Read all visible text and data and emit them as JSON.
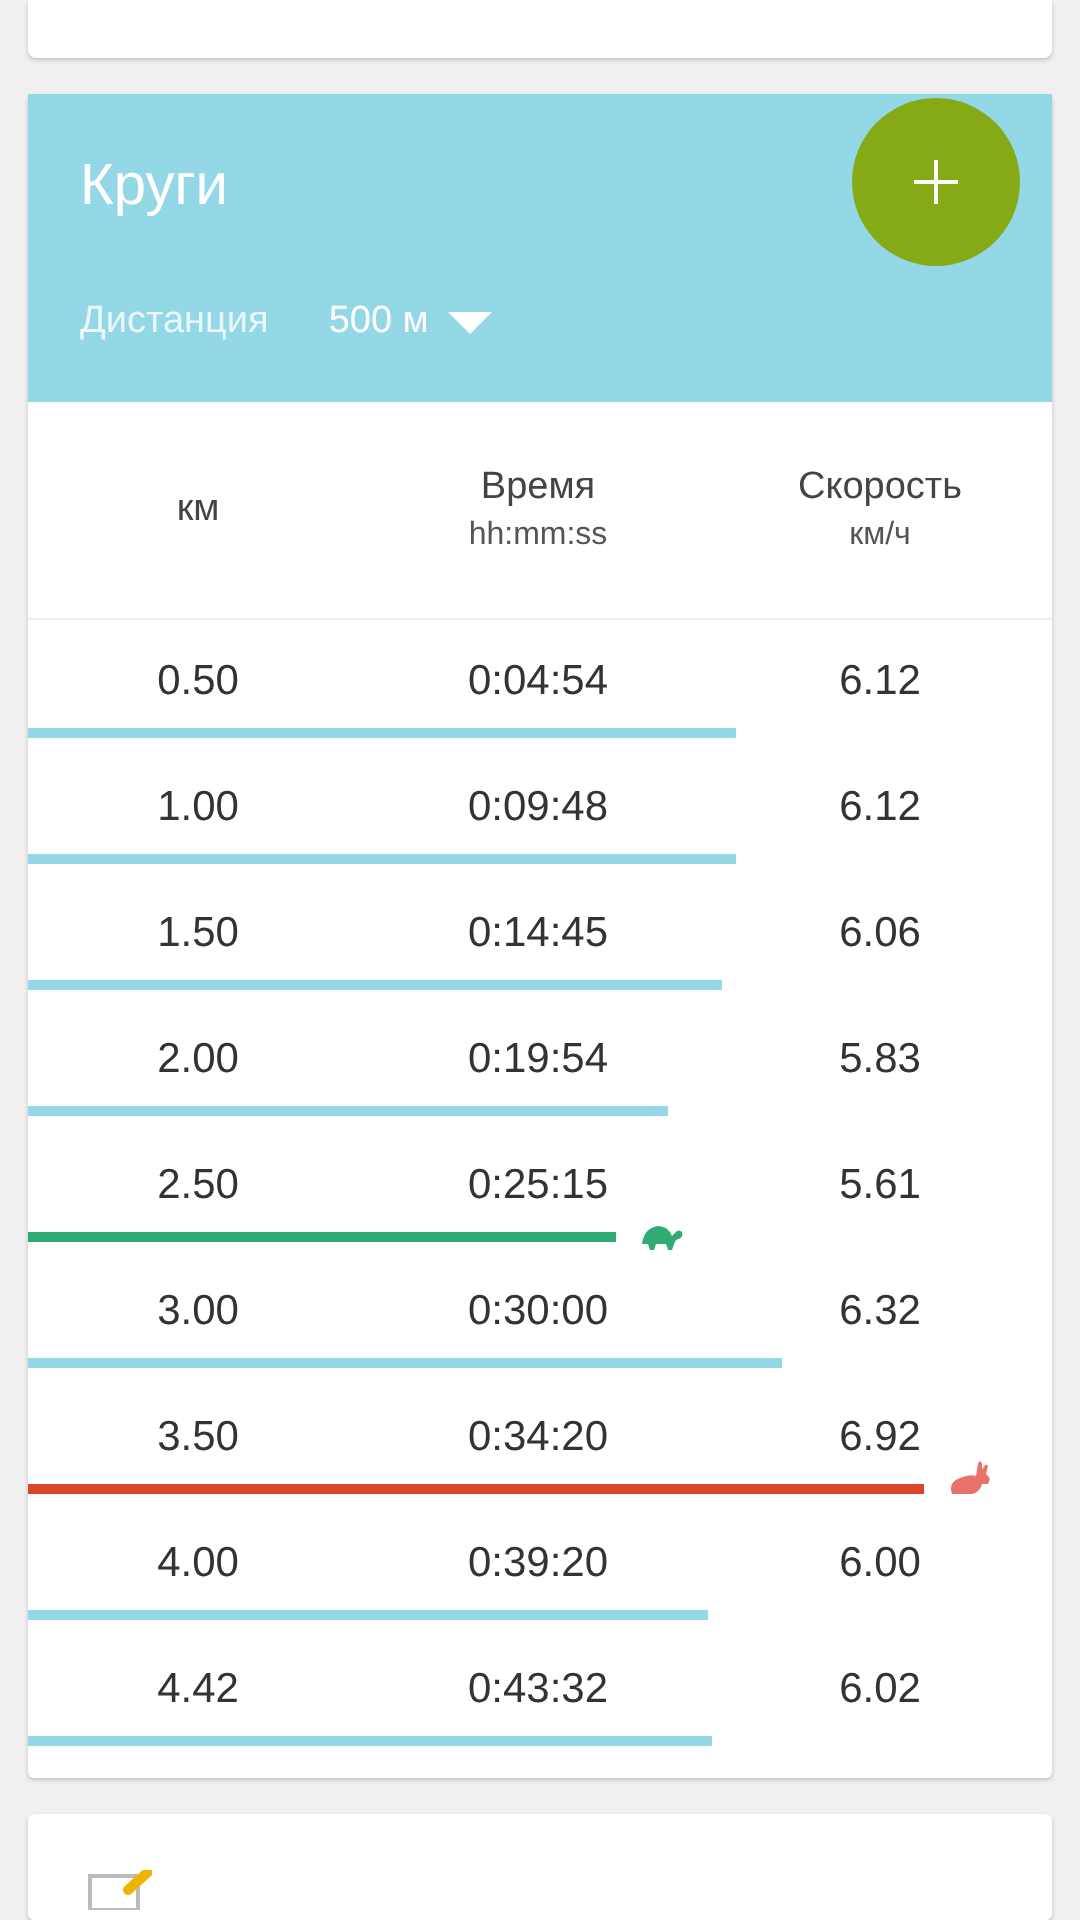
{
  "laps_card": {
    "title": "Круги",
    "distance_label": "Дистанция",
    "distance_value": "500 м",
    "columns": [
      {
        "label": "км"
      },
      {
        "label": "Время",
        "unit": "hh:mm:ss"
      },
      {
        "label": "Скорость",
        "unit": "км/ч"
      }
    ],
    "rows": [
      {
        "km": "0.50",
        "time": "0:04:54",
        "speed": "6.12",
        "kind": "normal"
      },
      {
        "km": "1.00",
        "time": "0:09:48",
        "speed": "6.12",
        "kind": "normal"
      },
      {
        "km": "1.50",
        "time": "0:14:45",
        "speed": "6.06",
        "kind": "normal"
      },
      {
        "km": "2.00",
        "time": "0:19:54",
        "speed": "5.83",
        "kind": "normal"
      },
      {
        "km": "2.50",
        "time": "0:25:15",
        "speed": "5.61",
        "kind": "slowest"
      },
      {
        "km": "3.00",
        "time": "0:30:00",
        "speed": "6.32",
        "kind": "normal"
      },
      {
        "km": "3.50",
        "time": "0:34:20",
        "speed": "6.92",
        "kind": "fastest"
      },
      {
        "km": "4.00",
        "time": "0:39:20",
        "speed": "6.00",
        "kind": "normal"
      },
      {
        "km": "4.42",
        "time": "0:43:32",
        "speed": "6.02",
        "kind": "normal"
      }
    ]
  }
}
